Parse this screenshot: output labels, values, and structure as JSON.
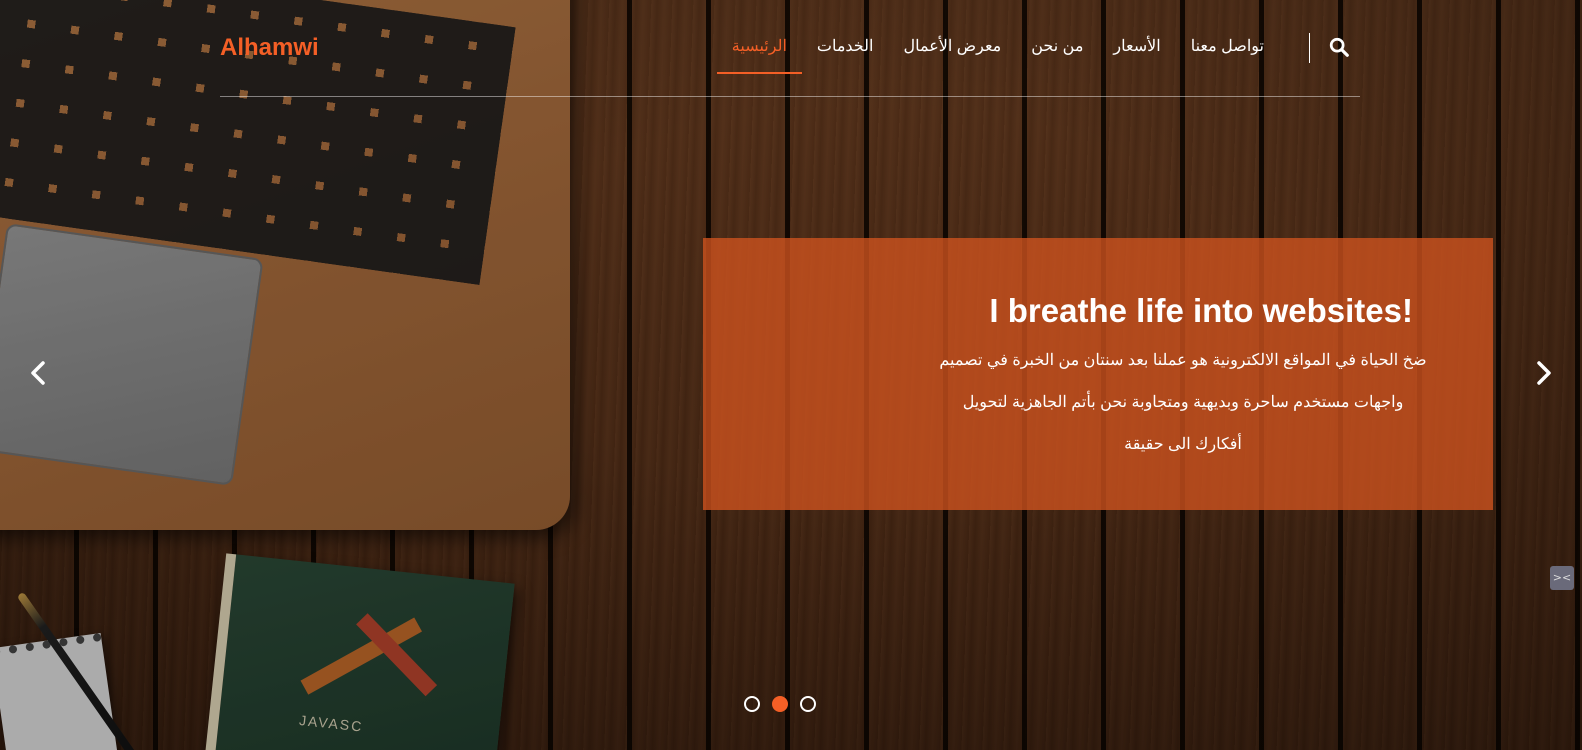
{
  "brand": "Alhamwi",
  "nav": {
    "items": [
      {
        "label": "الرئيسية",
        "active": true
      },
      {
        "label": "الخدمات",
        "active": false
      },
      {
        "label": "معرض الأعمال",
        "active": false
      },
      {
        "label": "من نحن",
        "active": false
      },
      {
        "label": "الأسعار",
        "active": false
      },
      {
        "label": "تواصل معنا",
        "active": false
      }
    ],
    "search_icon": "search-icon"
  },
  "slide": {
    "title": "I breathe life into websites!",
    "text_line1": "ضخ الحياة في المواقع الالكترونية هو عملنا بعد سنتان من الخبرة في تصميم",
    "text_line2": "واجهات مستخدم ساحرة وبديهية ومتجاوبة نحن بأتم الجاهزية لتحويل",
    "text_line3": "أفكارك الى حقيقة"
  },
  "carousel": {
    "slide_count": 3,
    "active_index": 1,
    "prev_icon": "chevron-left-icon",
    "next_icon": "chevron-right-icon"
  },
  "decor": {
    "book_label": "JAVASC"
  },
  "colors": {
    "accent": "#f45f26",
    "caption_bg": "#cf531f"
  }
}
